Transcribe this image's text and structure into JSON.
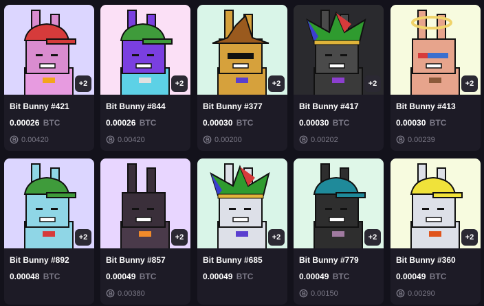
{
  "cards": [
    {
      "name": "Bit Bunny #421",
      "price": "0.00026",
      "currency": "BTC",
      "last_sale": "0.00420",
      "extra": "+2",
      "bg": "#dcd6ff",
      "body": "#e79be0",
      "hat": "#d63b3b",
      "hat_type": "cap",
      "face_color": "#d98ccf",
      "accent": "#f3a51c"
    },
    {
      "name": "Bit Bunny #844",
      "price": "0.00026",
      "currency": "BTC",
      "last_sale": "0.00420",
      "extra": "+2",
      "bg": "#fbe0f6",
      "body": "#5dd1e6",
      "hat": "#3f9b3b",
      "hat_type": "cap",
      "face_color": "#7a3fe0",
      "accent": "#e0e0e0"
    },
    {
      "name": "Bit Bunny #377",
      "price": "0.00030",
      "currency": "BTC",
      "last_sale": "0.00200",
      "extra": "+2",
      "bg": "#d9f5e8",
      "body": "#d6a13c",
      "hat": "#9a5a1e",
      "hat_type": "witch",
      "face_color": "#d6a13c",
      "accent": "#5a3fcf"
    },
    {
      "name": "Bit Bunny #417",
      "price": "0.00030",
      "currency": "BTC",
      "last_sale": "0.00202",
      "extra": "+2",
      "bg": "#2a2a2e",
      "body": "#3a3a3a",
      "hat": "#2f9b2f",
      "hat_type": "jester",
      "face_color": "#4a4a4a",
      "accent": "#8c3fcf"
    },
    {
      "name": "Bit Bunny #413",
      "price": "0.00030",
      "currency": "BTC",
      "last_sale": "0.00239",
      "extra": "+2",
      "bg": "#f7fbdf",
      "body": "#e7a48c",
      "hat": "#f0d36a",
      "hat_type": "halo",
      "face_color": "#e7a48c",
      "accent": "#8c5a3a"
    },
    {
      "name": "Bit Bunny #892",
      "price": "0.00048",
      "currency": "BTC",
      "last_sale": "",
      "extra": "+2",
      "bg": "#dcd6ff",
      "body": "#8fd6e6",
      "hat": "#3f9b3b",
      "hat_type": "cap",
      "face_color": "#8fd6e6",
      "accent": "#d63b3b"
    },
    {
      "name": "Bit Bunny #857",
      "price": "0.00049",
      "currency": "BTC",
      "last_sale": "0.00380",
      "extra": "+2",
      "bg": "#e8d6ff",
      "body": "#4a3a4a",
      "hat": "#3a2f3a",
      "hat_type": "none",
      "face_color": "#3a2f3a",
      "accent": "#f08a2a"
    },
    {
      "name": "Bit Bunny #685",
      "price": "0.00049",
      "currency": "BTC",
      "last_sale": "",
      "extra": "+2",
      "bg": "#d9f5e8",
      "body": "#dde0e8",
      "hat": "#2f9b2f",
      "hat_type": "jester",
      "face_color": "#dde0e8",
      "accent": "#5a3fcf"
    },
    {
      "name": "Bit Bunny #779",
      "price": "0.00049",
      "currency": "BTC",
      "last_sale": "0.00150",
      "extra": "+2",
      "bg": "#dff7e8",
      "body": "#2e2e2e",
      "hat": "#1f8a9a",
      "hat_type": "cap",
      "face_color": "#2e2e2e",
      "accent": "#a07aa0"
    },
    {
      "name": "Bit Bunny #360",
      "price": "0.00049",
      "currency": "BTC",
      "last_sale": "0.00290",
      "extra": "+2",
      "bg": "#f7fbdf",
      "body": "#dde0e8",
      "hat": "#f0e23a",
      "hat_type": "cap",
      "face_color": "#dde0e8",
      "accent": "#e0541c"
    }
  ]
}
